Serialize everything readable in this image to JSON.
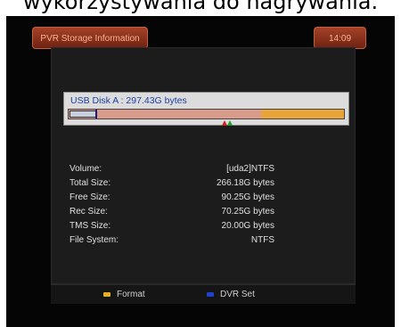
{
  "caption": "wykorzystywania do nagrywania.",
  "header": {
    "title": "PVR Storage Information",
    "time": "14:09"
  },
  "disk": {
    "label": "USB Disk A : 297.43G bytes",
    "used_fraction": 0.7
  },
  "info": {
    "rows": [
      {
        "key": "Volume:",
        "value": "[uda2]NTFS"
      },
      {
        "key": "Total Size:",
        "value": "266.18G bytes"
      },
      {
        "key": "Free Size:",
        "value": "90.25G bytes"
      },
      {
        "key": "Rec Size:",
        "value": "70.25G bytes"
      },
      {
        "key": "TMS Size:",
        "value": "20.00G bytes"
      },
      {
        "key": "File System:",
        "value": "NTFS"
      }
    ]
  },
  "footer": {
    "format": {
      "label": "Format",
      "color": "#e8b020"
    },
    "dvr_set": {
      "label": "DVR Set",
      "color": "#2040d0"
    }
  }
}
